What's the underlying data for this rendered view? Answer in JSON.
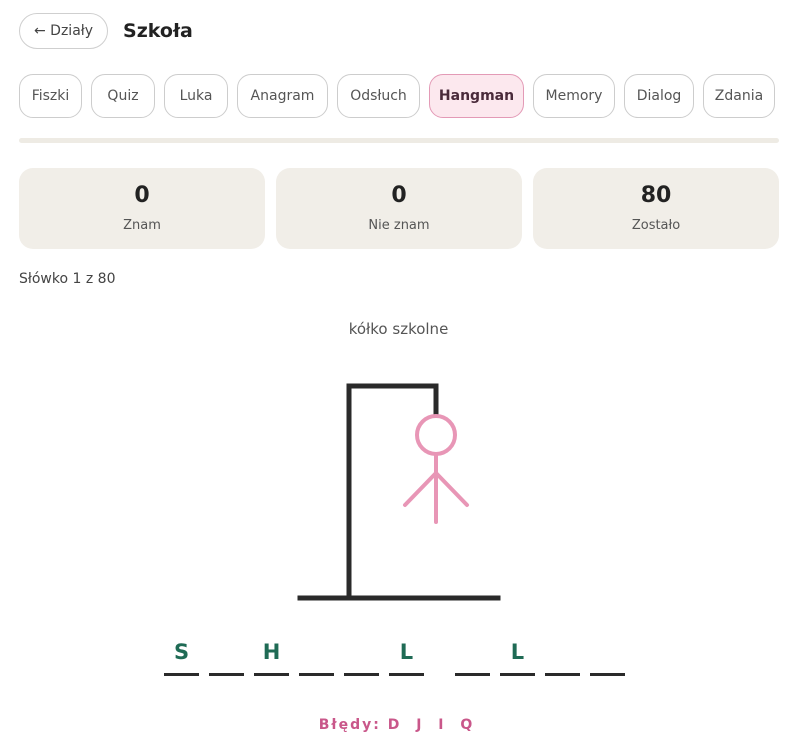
{
  "header": {
    "back_label": "← Działy",
    "title": "Szkoła"
  },
  "tabs": [
    {
      "label": "Fiszki",
      "active": false
    },
    {
      "label": "Quiz",
      "active": false
    },
    {
      "label": "Luka",
      "active": false
    },
    {
      "label": "Anagram",
      "active": false
    },
    {
      "label": "Odsłuch",
      "active": false
    },
    {
      "label": "Hangman",
      "active": true
    },
    {
      "label": "Memory",
      "active": false
    },
    {
      "label": "Dialog",
      "active": false
    },
    {
      "label": "Zdania",
      "active": false
    }
  ],
  "progress": {
    "fraction": 0.0
  },
  "stats": [
    {
      "value": "0",
      "label": "Znam"
    },
    {
      "value": "0",
      "label": "Nie znam"
    },
    {
      "value": "80",
      "label": "Zostało"
    }
  ],
  "counter": "Słówko 1 z 80",
  "hint": "kółko szkolne",
  "word": [
    [
      "S",
      "",
      "H",
      "",
      "",
      "L"
    ],
    [
      "",
      "L",
      "",
      ""
    ]
  ],
  "errors": {
    "label": "Błędy:",
    "letters": "D J I Q",
    "count": 4
  },
  "colors": {
    "accent": "#e39ab6",
    "active_tab_bg": "#fce8ee",
    "correct_letter": "#1f6b55",
    "error_text": "#c9578a",
    "stat_bg": "#f1eee8",
    "gallows": "#2a2a2a"
  }
}
